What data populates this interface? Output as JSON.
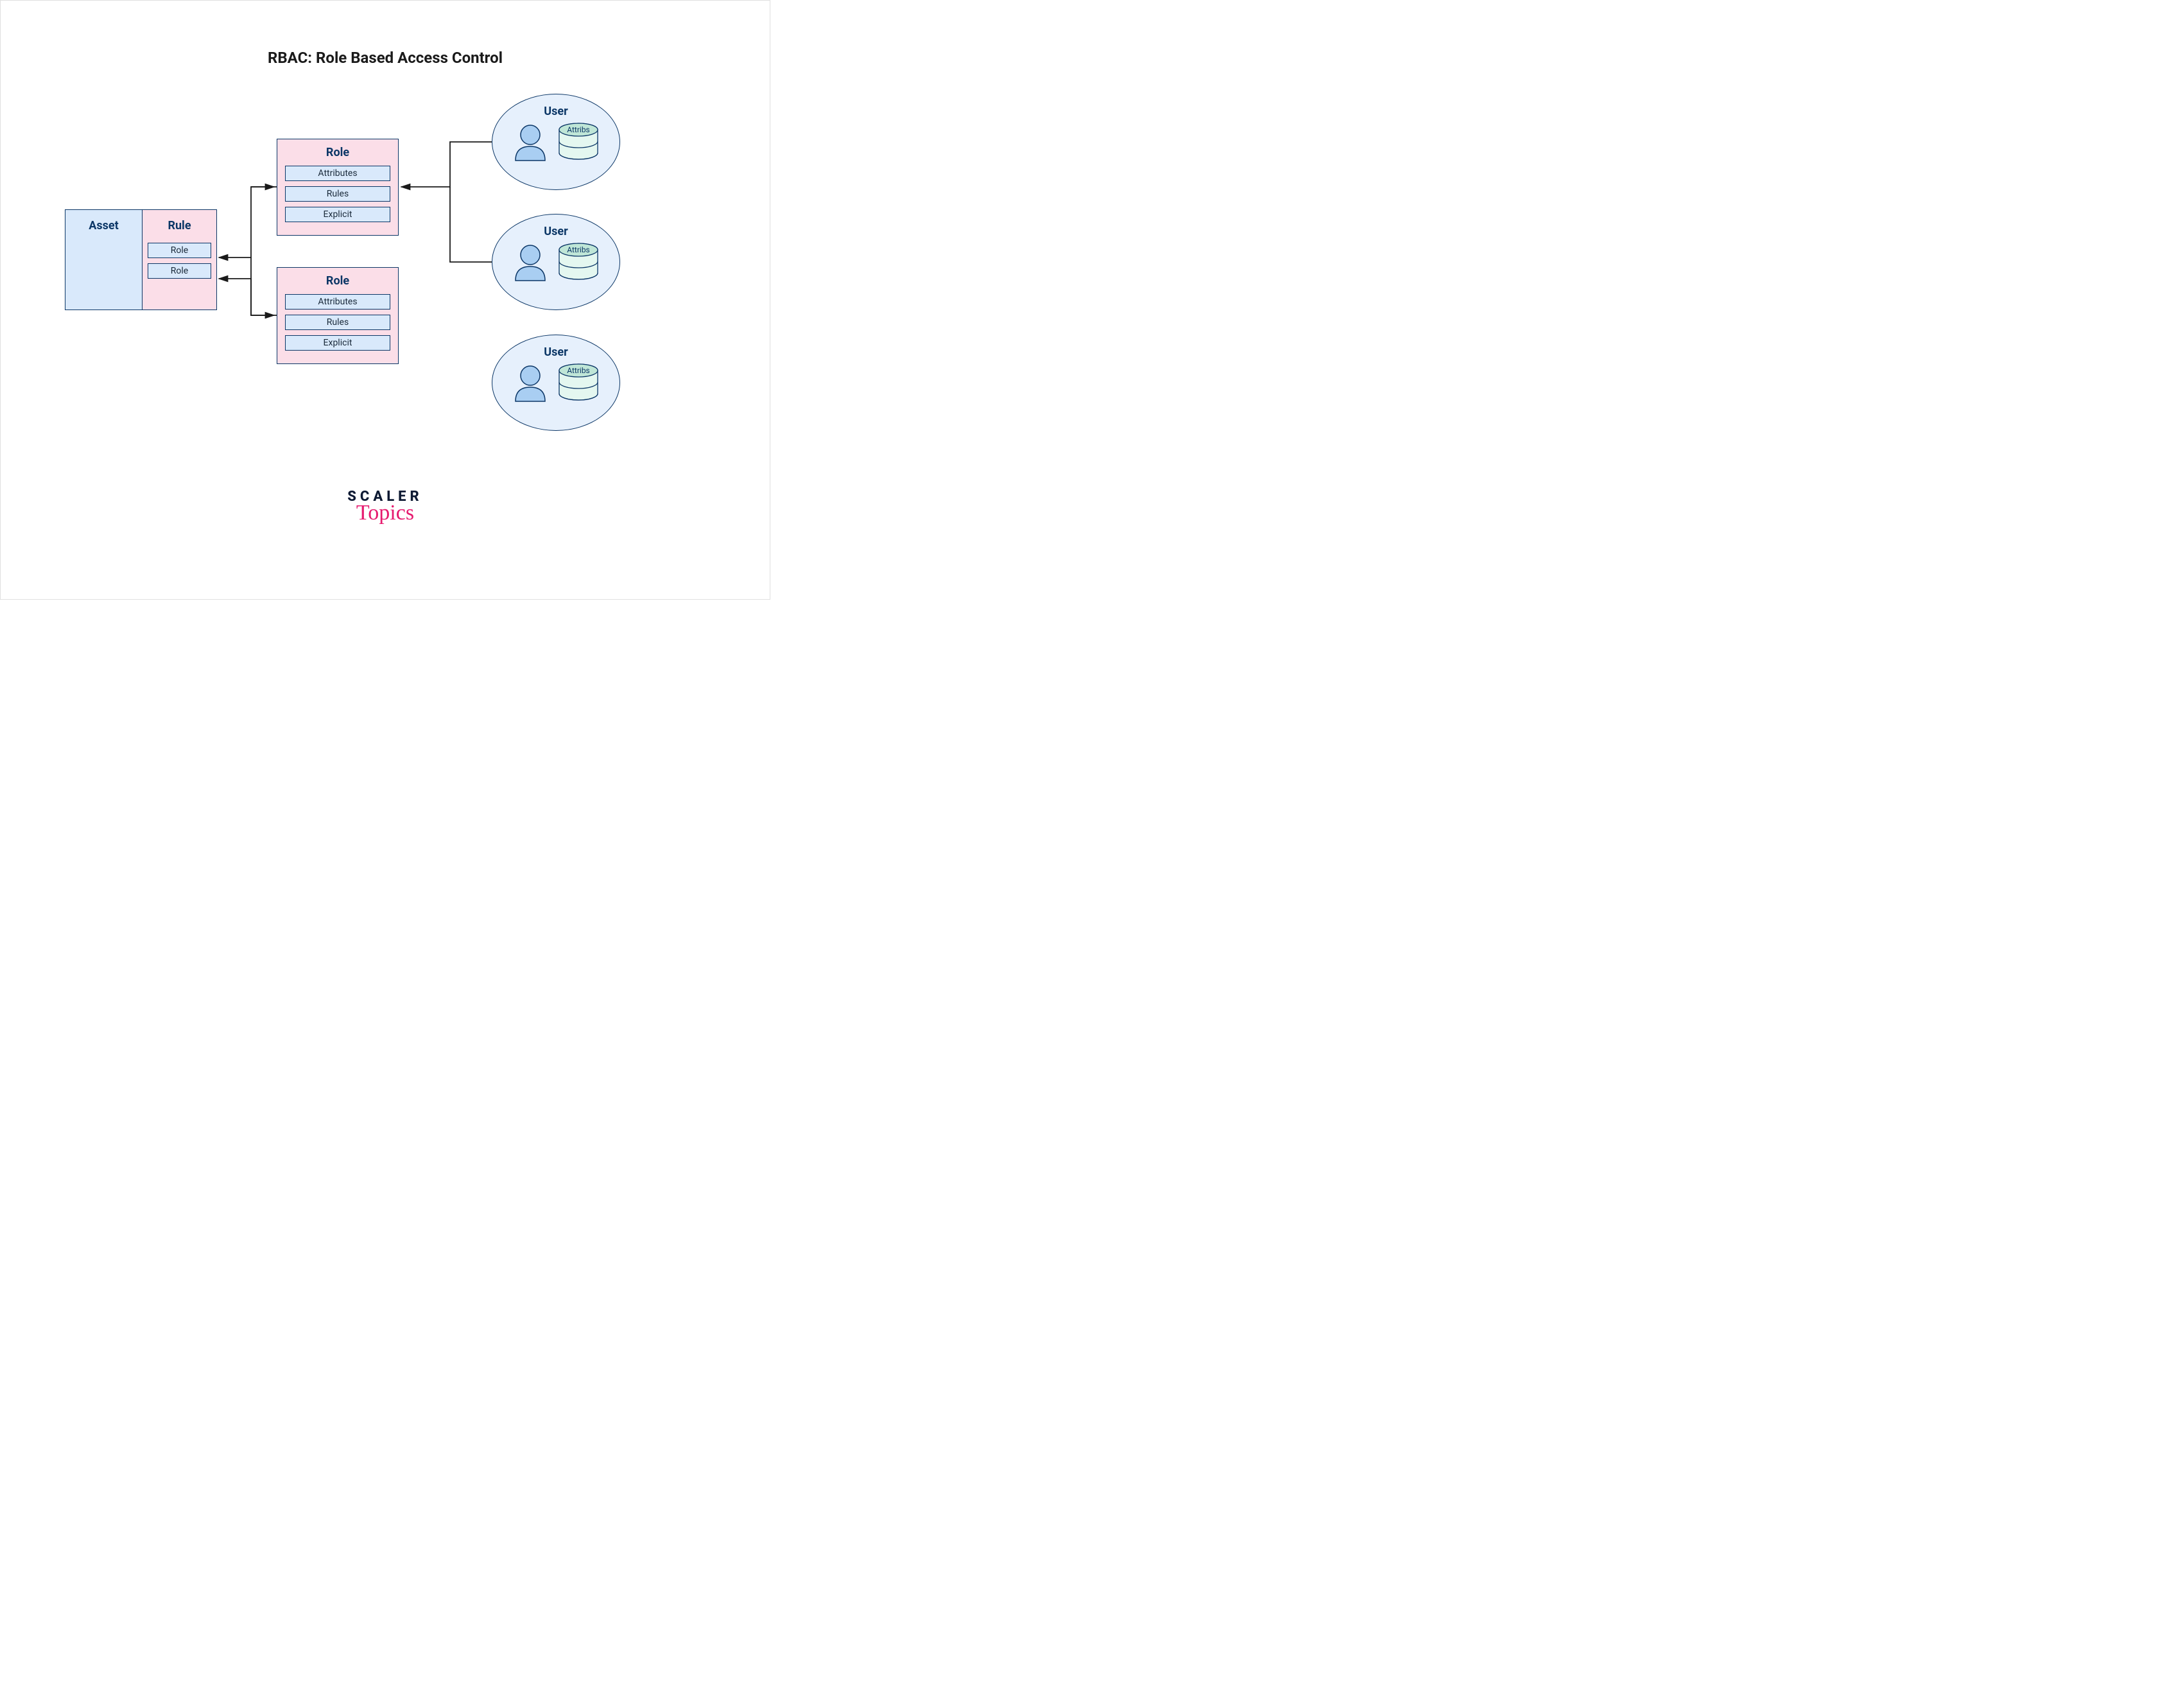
{
  "title": "RBAC: Role Based Access Control",
  "assetRule": {
    "assetLabel": "Asset",
    "ruleLabel": "Rule",
    "items": [
      "Role",
      "Role"
    ]
  },
  "roles": [
    {
      "title": "Role",
      "items": [
        "Attributes",
        "Rules",
        "Explicit"
      ]
    },
    {
      "title": "Role",
      "items": [
        "Attributes",
        "Rules",
        "Explicit"
      ]
    }
  ],
  "users": [
    {
      "title": "User",
      "dbLabel": "Attribs"
    },
    {
      "title": "User",
      "dbLabel": "Attribs"
    },
    {
      "title": "User",
      "dbLabel": "Attribs"
    }
  ],
  "footer": {
    "line1": "SCALER",
    "line2": "Topics"
  },
  "colors": {
    "border": "#0b3666",
    "blueFill": "#d9e9fb",
    "pinkFill": "#fbdee8",
    "ellipseFill": "#e6f0fc",
    "tealFill": "#bfe6d7",
    "mintFill": "#e4f7f0",
    "avatarFill": "#a9cef2",
    "arrow": "#1a1a1a"
  }
}
